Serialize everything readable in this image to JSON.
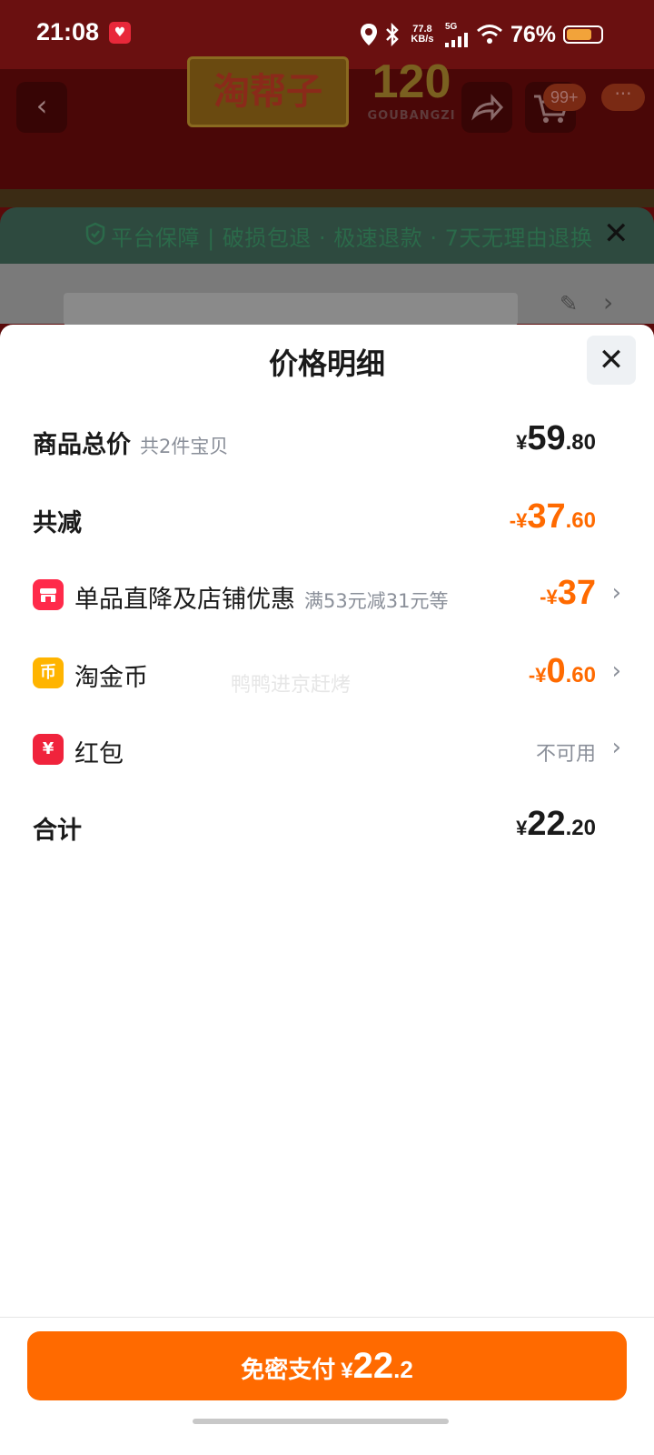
{
  "status_bar": {
    "time": "21:08",
    "speed_top": "77.8",
    "speed_bottom": "KB/s",
    "network": "5G",
    "battery": "76%",
    "battery_level": 0.76
  },
  "nav": {
    "logo": "淘帮子",
    "anniversary": "120",
    "anniversary_sub": "GOUBANGZI",
    "cart_badge": "99+",
    "more": "···"
  },
  "guarantee": {
    "text": "平台保障 | 破损包退 · 极速退款 · 7天无理由退换"
  },
  "sheet": {
    "title": "价格明细",
    "watermark": "鸭鸭进京赶烤",
    "rows": [
      {
        "label": "商品总价",
        "note": "共2件宝贝",
        "sym": "¥",
        "int": "59",
        "dec": ".80"
      },
      {
        "label": "共减",
        "sym": "-¥",
        "int": "37",
        "dec": ".60"
      },
      {
        "label": "单品直降及店铺优惠",
        "note": "满53元减31元等",
        "sym": "-¥",
        "int": "37",
        "dec": "",
        "icon": "store-icon"
      },
      {
        "label": "淘金币",
        "sym": "-¥",
        "int": "0",
        "dec": ".60",
        "icon": "coin-icon"
      },
      {
        "label": "红包",
        "status": "不可用",
        "icon": "red-packet-icon"
      },
      {
        "label": "合计",
        "sym": "¥",
        "int": "22",
        "dec": ".20"
      }
    ]
  },
  "pay_button": {
    "label": "免密支付",
    "sym": "¥",
    "int": "22",
    "dec": ".2"
  },
  "colors": {
    "accent": "#ff6a00",
    "store_icon": "#ff2a4a",
    "coin_icon": "#ffb400",
    "red_packet_icon": "#f0233c"
  }
}
